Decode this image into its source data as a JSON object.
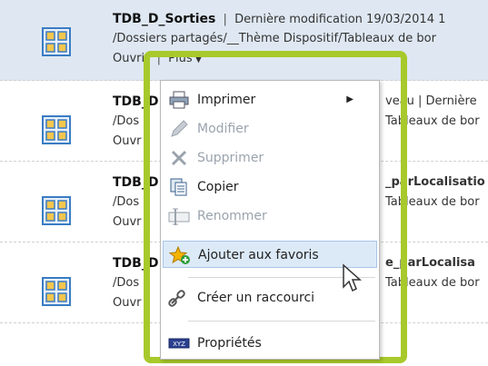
{
  "rows": [
    {
      "title": "TDB_D_Sorties",
      "meta": "Dernière modification 19/03/2014 1",
      "path": "/Dossiers partagés/__Thème Dispositif/Tableaux de bor",
      "open": "Ouvrir",
      "more": "Plus"
    },
    {
      "title": "TDB_D",
      "meta": "veau | Dernière",
      "path": "/Dos",
      "path_right": "Tableaux de bor",
      "open": "Ouvr"
    },
    {
      "title": "TDB_D",
      "meta": "_parLocalisatio",
      "path": "/Dos",
      "path_right": "Tableaux de bor",
      "open": "Ouvr"
    },
    {
      "title": "TDB_D",
      "meta": "e_parLocalisa",
      "path": "/Dos",
      "path_right": "Tableaux de bor",
      "open": "Ouvr"
    }
  ],
  "menu": {
    "items": [
      {
        "label": "Imprimer",
        "icon": "printer-icon",
        "disabled": false,
        "submenu": true
      },
      {
        "label": "Modifier",
        "icon": "pencil-icon",
        "disabled": true
      },
      {
        "label": "Supprimer",
        "icon": "delete-x-icon",
        "disabled": true
      },
      {
        "label": "Copier",
        "icon": "copy-icon",
        "disabled": false
      },
      {
        "label": "Renommer",
        "icon": "rename-icon",
        "disabled": true
      },
      {
        "label": "Ajouter aux favoris",
        "icon": "favorite-star-icon",
        "disabled": false,
        "hover": true
      },
      {
        "label": "Créer un raccourci",
        "icon": "shortcut-link-icon",
        "disabled": false
      },
      {
        "label": "Propriétés",
        "icon": "properties-icon",
        "disabled": false
      }
    ]
  },
  "colors": {
    "highlight_frame": "#a8c92b",
    "row_selected": "#dfe8f2",
    "menu_hover": "#dceaf8",
    "disabled_text": "#9aa3ad"
  }
}
